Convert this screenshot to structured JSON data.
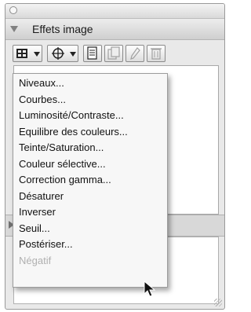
{
  "panel": {
    "section_title": "Effets image"
  },
  "toolbar": {
    "buttons": [
      {
        "name": "adjustments-dropdown",
        "icon": "grid-icon"
      },
      {
        "name": "filters-dropdown",
        "icon": "crosshair-icon"
      },
      {
        "name": "new-effect",
        "icon": "document-icon"
      },
      {
        "name": "duplicate-effect",
        "icon": "duplicate-icon"
      },
      {
        "name": "edit-effect",
        "icon": "pencil-icon"
      },
      {
        "name": "delete-effect",
        "icon": "trash-icon"
      }
    ]
  },
  "menu": {
    "items": [
      {
        "label": "Niveaux...",
        "enabled": true
      },
      {
        "label": "Courbes...",
        "enabled": true
      },
      {
        "label": "Luminosité/Contraste...",
        "enabled": true
      },
      {
        "label": "Equilibre des couleurs...",
        "enabled": true
      },
      {
        "label": "Teinte/Saturation...",
        "enabled": true
      },
      {
        "label": "Couleur sélective...",
        "enabled": true
      },
      {
        "label": "Correction gamma...",
        "enabled": true
      },
      {
        "label": "Désaturer",
        "enabled": true
      },
      {
        "label": "Inverser",
        "enabled": true
      },
      {
        "label": "Seuil...",
        "enabled": true
      },
      {
        "label": "Postériser...",
        "enabled": true
      },
      {
        "label": "Négatif",
        "enabled": false
      }
    ]
  },
  "colors": {
    "menu_text": "#111111",
    "disabled_text": "#b0b0b0",
    "panel_bg": "#e9e9e9"
  }
}
